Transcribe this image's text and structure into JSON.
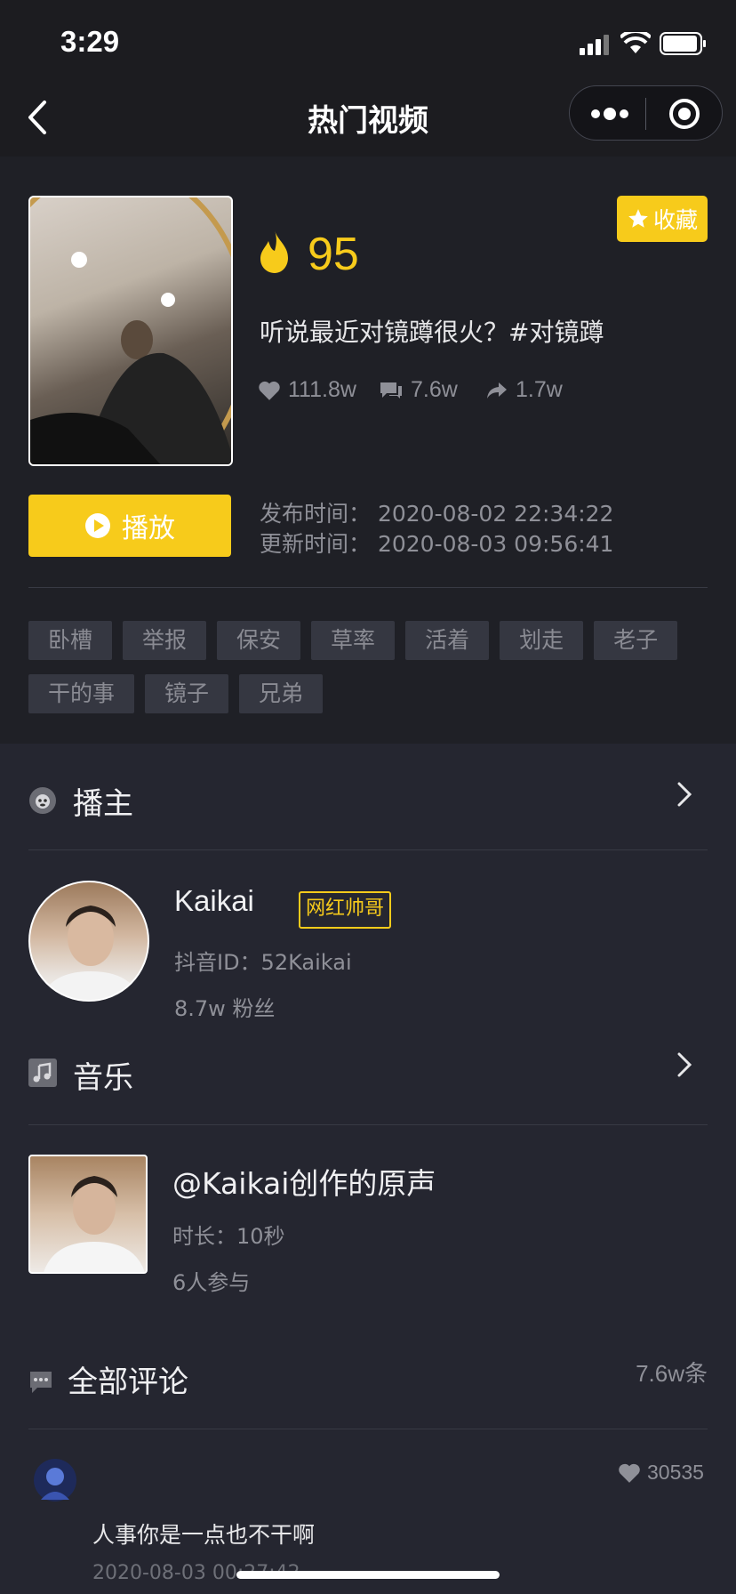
{
  "status_bar": {
    "time": "3:29"
  },
  "nav": {
    "title": "热门视频"
  },
  "video": {
    "favorite_label": "收藏",
    "heat": "95",
    "title": "听说最近对镜蹲很火？#对镜蹲",
    "likes": "111.8w",
    "comments": "7.6w",
    "shares": "1.7w",
    "play_label": "播放",
    "publish_time": "发布时间：  2020-08-02 22:34:22",
    "update_time": "更新时间：  2020-08-03 09:56:41"
  },
  "tags": [
    "卧槽",
    "举报",
    "保安",
    "草率",
    "活着",
    "划走",
    "老子",
    "干的事",
    "镜子",
    "兄弟"
  ],
  "host": {
    "section_title": "播主",
    "name": "Kaikai",
    "badge": "网红帅哥",
    "douyin_id": "抖音ID：52Kaikai",
    "fans": "8.7w 粉丝"
  },
  "music": {
    "section_title": "音乐",
    "title": "@Kaikai创作的原声",
    "duration": "时长：10秒",
    "participants": "6人参与"
  },
  "comments": {
    "section_title": "全部评论",
    "count": "7.6w条",
    "items": [
      {
        "likes": "30535",
        "text": "人事你是一点也不干啊",
        "time": "2020-08-03 00:27:42"
      }
    ]
  },
  "colors": {
    "accent": "#f7cb1b",
    "background": "#252630",
    "muted_text": "#8f9098"
  },
  "icons": [
    "back-icon",
    "more-icon",
    "target-icon",
    "star-icon",
    "flame-icon",
    "heart-icon",
    "comment-icon",
    "share-icon",
    "play-circle-icon",
    "monkey-icon",
    "music-note-icon",
    "chat-icon",
    "chevron-right-icon"
  ]
}
